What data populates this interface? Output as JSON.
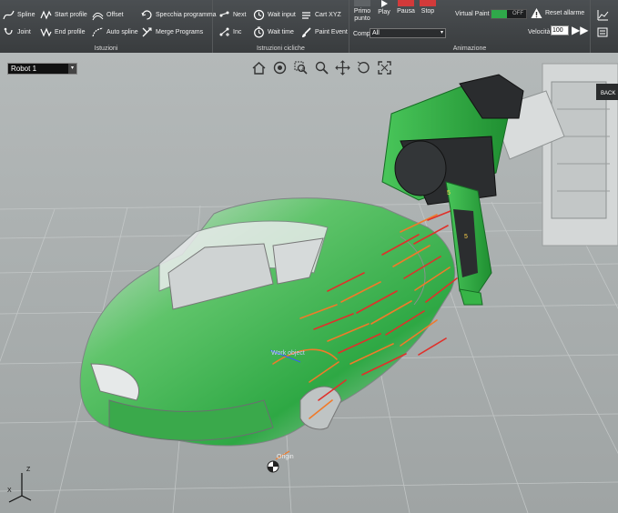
{
  "ribbon": {
    "istruzioni": {
      "label": "Istuzioni",
      "items": {
        "spline": "Spline",
        "start_profile": "Start profile",
        "offset": "Offset",
        "specchia": "Specchia programma",
        "joint": "Joint",
        "end_profile": "End profile",
        "auto_spline": "Auto spline",
        "merge": "Merge Programs"
      }
    },
    "istruzioni_cicliche": {
      "label": "Istruzioni cicliche",
      "items": {
        "next": "Next",
        "wait_input": "Wait input",
        "cart_xyz": "Cart XYZ",
        "inc": "Inc",
        "wait_time": "Wait time",
        "paint_event": "Paint Event"
      }
    },
    "animazione": {
      "label": "Animazione",
      "primo_punto": "Primo punto",
      "play": "Play",
      "pausa": "Pausa",
      "stop": "Stop",
      "comp_label": "Comp",
      "comp_value": "All",
      "virtual_paint": "Virtual Paint",
      "virtual_paint_state": "OFF",
      "reset_allarme": "Reset allarme",
      "velocita_label": "Velocità",
      "velocita_value": "100"
    }
  },
  "viewport": {
    "robot_select": "Robot 1",
    "work_object_label": "Work object",
    "origin_label": "Origin",
    "axis_z": "Z",
    "axis_x": "X",
    "back_label": "BACK",
    "path_number": "5"
  },
  "colors": {
    "ribbon_bg": "#414547",
    "viewport_bg": "#a9aeae",
    "robot_green": "#2fb33c",
    "path_red": "#e0302a",
    "path_orange": "#f07a2a",
    "toggle_on": "#2fa84a",
    "stop_red": "#d23a3a"
  }
}
